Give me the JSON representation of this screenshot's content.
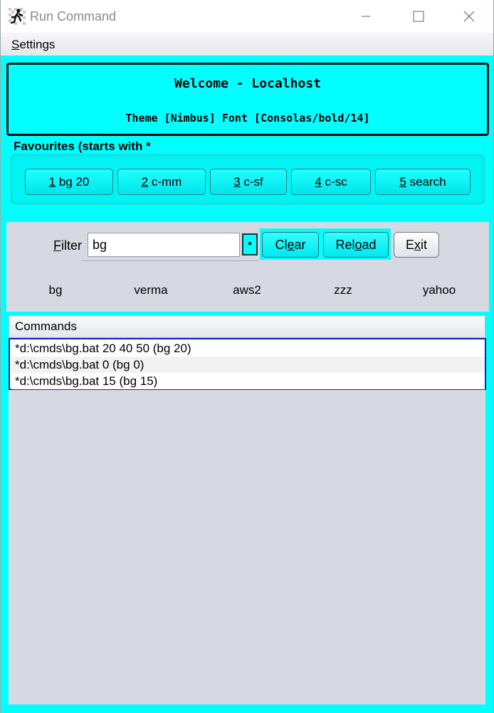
{
  "window": {
    "title": "Run Command",
    "minimize": "—",
    "maximize": "☐",
    "close": "✕"
  },
  "menu": {
    "settings_first": "S",
    "settings_rest": "ettings"
  },
  "welcome": {
    "title": "Welcome - Localhost",
    "subtitle": "Theme [Nimbus] Font [Consolas/bold/14]"
  },
  "favourites": {
    "label": "Favourites (starts with *",
    "buttons": [
      {
        "num": "1",
        "label": " bg 20"
      },
      {
        "num": "2",
        "label": " c-mm"
      },
      {
        "num": "3",
        "label": " c-sf"
      },
      {
        "num": "4",
        "label": " c-sc"
      },
      {
        "num": "5",
        "label": " search"
      }
    ]
  },
  "filter": {
    "label_first": "F",
    "label_rest": "ilter",
    "value": "bg",
    "star": "*",
    "clear": {
      "pre": "Cl",
      "u": "e",
      "post": "ar"
    },
    "reload": {
      "pre": "Rel",
      "u": "o",
      "post": "ad"
    },
    "exit": {
      "pre": "E",
      "u": "x",
      "post": "it"
    }
  },
  "quick_commands": [
    "bg",
    "verma",
    "aws2",
    "zzz",
    "yahoo"
  ],
  "commands": {
    "header": "Commands",
    "rows": [
      "*d:\\cmds\\bg.bat 20 40 50 (bg 20)",
      "*d:\\cmds\\bg.bat 0 (bg 0)",
      "*d:\\cmds\\bg.bat 15 (bg 15)"
    ]
  },
  "colors": {
    "accent": "#00ffff",
    "panel": "#d6d9e1",
    "selection_border": "#1022c8"
  }
}
